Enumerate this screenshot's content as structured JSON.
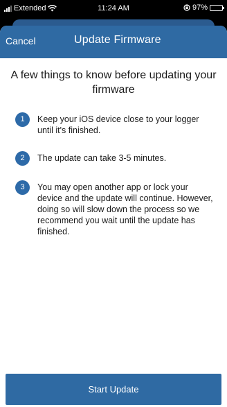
{
  "status_bar": {
    "carrier": "Extended",
    "time": "11:24 AM",
    "battery": "97%",
    "battery_level": 0.97,
    "battery_color": "#4cd964"
  },
  "nav": {
    "cancel_label": "Cancel",
    "title": "Update Firmware",
    "background_color": "#2f6aa3"
  },
  "heading": "A few things to know before updating your firmware",
  "steps": [
    {
      "number": "1",
      "text": "Keep your iOS device close to your logger until it's finished."
    },
    {
      "number": "2",
      "text": "The update can take 3-5 minutes."
    },
    {
      "number": "3",
      "text": "You may open another app or lock your device and the update will continue. However, doing so will slow down the process so we recommend you wait until the update has finished."
    }
  ],
  "start_button": {
    "label": "Start Update"
  },
  "icons": {
    "signal": "cellular-signal-icon",
    "wifi": "wifi-icon",
    "orientation_lock": "orientation-lock-icon",
    "battery": "battery-charging-icon"
  }
}
